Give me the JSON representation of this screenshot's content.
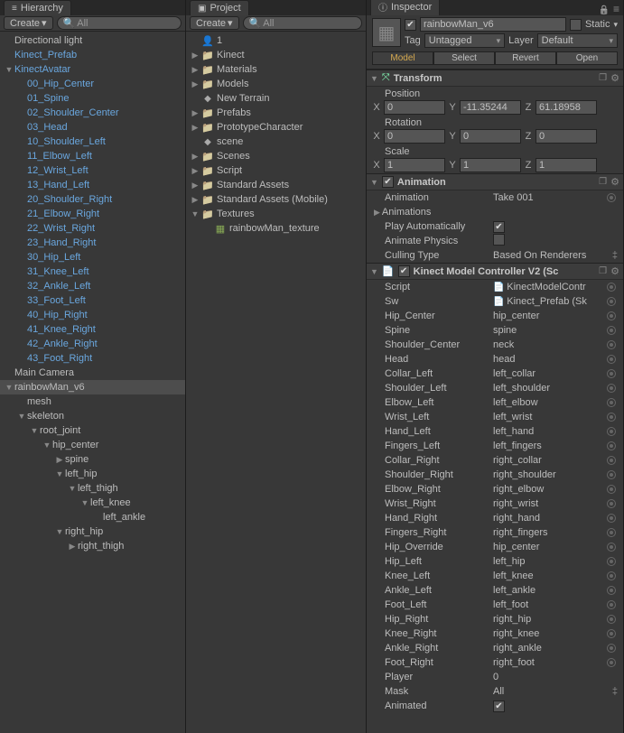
{
  "hierarchy": {
    "tab": "Hierarchy",
    "create": "Create",
    "search": "All",
    "items": [
      {
        "label": "Directional light",
        "depth": 0,
        "arrow": "",
        "blue": false
      },
      {
        "label": "Kinect_Prefab",
        "depth": 0,
        "arrow": "",
        "blue": true
      },
      {
        "label": "KinectAvatar",
        "depth": 0,
        "arrow": "▼",
        "blue": true
      },
      {
        "label": "00_Hip_Center",
        "depth": 1,
        "arrow": "",
        "blue": true
      },
      {
        "label": "01_Spine",
        "depth": 1,
        "arrow": "",
        "blue": true
      },
      {
        "label": "02_Shoulder_Center",
        "depth": 1,
        "arrow": "",
        "blue": true
      },
      {
        "label": "03_Head",
        "depth": 1,
        "arrow": "",
        "blue": true
      },
      {
        "label": "10_Shoulder_Left",
        "depth": 1,
        "arrow": "",
        "blue": true
      },
      {
        "label": "11_Elbow_Left",
        "depth": 1,
        "arrow": "",
        "blue": true
      },
      {
        "label": "12_Wrist_Left",
        "depth": 1,
        "arrow": "",
        "blue": true
      },
      {
        "label": "13_Hand_Left",
        "depth": 1,
        "arrow": "",
        "blue": true
      },
      {
        "label": "20_Shoulder_Right",
        "depth": 1,
        "arrow": "",
        "blue": true
      },
      {
        "label": "21_Elbow_Right",
        "depth": 1,
        "arrow": "",
        "blue": true
      },
      {
        "label": "22_Wrist_Right",
        "depth": 1,
        "arrow": "",
        "blue": true
      },
      {
        "label": "23_Hand_Right",
        "depth": 1,
        "arrow": "",
        "blue": true
      },
      {
        "label": "30_Hip_Left",
        "depth": 1,
        "arrow": "",
        "blue": true
      },
      {
        "label": "31_Knee_Left",
        "depth": 1,
        "arrow": "",
        "blue": true
      },
      {
        "label": "32_Ankle_Left",
        "depth": 1,
        "arrow": "",
        "blue": true
      },
      {
        "label": "33_Foot_Left",
        "depth": 1,
        "arrow": "",
        "blue": true
      },
      {
        "label": "40_Hip_Right",
        "depth": 1,
        "arrow": "",
        "blue": true
      },
      {
        "label": "41_Knee_Right",
        "depth": 1,
        "arrow": "",
        "blue": true
      },
      {
        "label": "42_Ankle_Right",
        "depth": 1,
        "arrow": "",
        "blue": true
      },
      {
        "label": "43_Foot_Right",
        "depth": 1,
        "arrow": "",
        "blue": true
      },
      {
        "label": "Main Camera",
        "depth": 0,
        "arrow": "",
        "blue": false
      },
      {
        "label": "rainbowMan_v6",
        "depth": 0,
        "arrow": "▼",
        "blue": false,
        "selected": true
      },
      {
        "label": "mesh",
        "depth": 1,
        "arrow": "",
        "blue": false
      },
      {
        "label": "skeleton",
        "depth": 1,
        "arrow": "▼",
        "blue": false
      },
      {
        "label": "root_joint",
        "depth": 2,
        "arrow": "▼",
        "blue": false
      },
      {
        "label": "hip_center",
        "depth": 3,
        "arrow": "▼",
        "blue": false
      },
      {
        "label": "spine",
        "depth": 4,
        "arrow": "▶",
        "blue": false
      },
      {
        "label": "left_hip",
        "depth": 4,
        "arrow": "▼",
        "blue": false
      },
      {
        "label": "left_thigh",
        "depth": 5,
        "arrow": "▼",
        "blue": false
      },
      {
        "label": "left_knee",
        "depth": 6,
        "arrow": "▼",
        "blue": false
      },
      {
        "label": "left_ankle",
        "depth": 7,
        "arrow": "",
        "blue": false
      },
      {
        "label": "right_hip",
        "depth": 4,
        "arrow": "▼",
        "blue": false
      },
      {
        "label": "right_thigh",
        "depth": 5,
        "arrow": "▶",
        "blue": false
      }
    ]
  },
  "project": {
    "tab": "Project",
    "create": "Create",
    "search": "All",
    "items": [
      {
        "label": "1",
        "depth": 0,
        "arrow": "",
        "icon": "avatar"
      },
      {
        "label": "Kinect",
        "depth": 0,
        "arrow": "▶",
        "icon": "folder"
      },
      {
        "label": "Materials",
        "depth": 0,
        "arrow": "▶",
        "icon": "folder"
      },
      {
        "label": "Models",
        "depth": 0,
        "arrow": "▶",
        "icon": "folder"
      },
      {
        "label": "New Terrain",
        "depth": 0,
        "arrow": "",
        "icon": "scene"
      },
      {
        "label": "Prefabs",
        "depth": 0,
        "arrow": "▶",
        "icon": "folder"
      },
      {
        "label": "PrototypeCharacter",
        "depth": 0,
        "arrow": "▶",
        "icon": "folder"
      },
      {
        "label": "scene",
        "depth": 0,
        "arrow": "",
        "icon": "scene"
      },
      {
        "label": "Scenes",
        "depth": 0,
        "arrow": "▶",
        "icon": "folder"
      },
      {
        "label": "Script",
        "depth": 0,
        "arrow": "▶",
        "icon": "folder"
      },
      {
        "label": "Standard Assets",
        "depth": 0,
        "arrow": "▶",
        "icon": "folder"
      },
      {
        "label": "Standard Assets (Mobile)",
        "depth": 0,
        "arrow": "▶",
        "icon": "folder"
      },
      {
        "label": "Textures",
        "depth": 0,
        "arrow": "▼",
        "icon": "folder"
      },
      {
        "label": "rainbowMan_texture",
        "depth": 1,
        "arrow": "",
        "icon": "tex"
      }
    ]
  },
  "inspector": {
    "tab": "Inspector",
    "name": "rainbowMan_v6",
    "enabled": true,
    "static_label": "Static",
    "tag_label": "Tag",
    "tag_value": "Untagged",
    "layer_label": "Layer",
    "layer_value": "Default",
    "buttons": {
      "model": "Model",
      "select": "Select",
      "revert": "Revert",
      "open": "Open"
    },
    "transform": {
      "title": "Transform",
      "pos_label": "Position",
      "pos": {
        "x": "0",
        "y": "-11.35244",
        "z": "61.18958"
      },
      "rot_label": "Rotation",
      "rot": {
        "x": "0",
        "y": "0",
        "z": "0"
      },
      "scale_label": "Scale",
      "scale": {
        "x": "1",
        "y": "1",
        "z": "1"
      },
      "axis": {
        "x": "X",
        "y": "Y",
        "z": "Z"
      }
    },
    "animation": {
      "title": "Animation",
      "rows": [
        {
          "label": "Animation",
          "value": "Take 001",
          "obj": true
        },
        {
          "label": "Animations",
          "value": "",
          "arrow": "▶"
        },
        {
          "label": "Play Automatically",
          "value": "",
          "check": true
        },
        {
          "label": "Animate Physics",
          "value": "",
          "check": false
        },
        {
          "label": "Culling Type",
          "value": "Based On Renderers",
          "dropdown": true
        }
      ]
    },
    "kinect": {
      "title": "Kinect Model Controller V2 (Sc",
      "rows": [
        {
          "label": "Script",
          "value": "KinectModelContr",
          "obj": true,
          "icon": "script"
        },
        {
          "label": "Sw",
          "value": "Kinect_Prefab (Sk",
          "obj": true,
          "icon": "script"
        },
        {
          "label": "Hip_Center",
          "value": "hip_center",
          "obj": true
        },
        {
          "label": "Spine",
          "value": "spine",
          "obj": true
        },
        {
          "label": "Shoulder_Center",
          "value": "neck",
          "obj": true
        },
        {
          "label": "Head",
          "value": "head",
          "obj": true
        },
        {
          "label": "Collar_Left",
          "value": "left_collar",
          "obj": true
        },
        {
          "label": "Shoulder_Left",
          "value": "left_shoulder",
          "obj": true
        },
        {
          "label": "Elbow_Left",
          "value": "left_elbow",
          "obj": true
        },
        {
          "label": "Wrist_Left",
          "value": "left_wrist",
          "obj": true
        },
        {
          "label": "Hand_Left",
          "value": "left_hand",
          "obj": true
        },
        {
          "label": "Fingers_Left",
          "value": "left_fingers",
          "obj": true
        },
        {
          "label": "Collar_Right",
          "value": "right_collar",
          "obj": true
        },
        {
          "label": "Shoulder_Right",
          "value": "right_shoulder",
          "obj": true
        },
        {
          "label": "Elbow_Right",
          "value": "right_elbow",
          "obj": true
        },
        {
          "label": "Wrist_Right",
          "value": "right_wrist",
          "obj": true
        },
        {
          "label": "Hand_Right",
          "value": "right_hand",
          "obj": true
        },
        {
          "label": "Fingers_Right",
          "value": "right_fingers",
          "obj": true
        },
        {
          "label": "Hip_Override",
          "value": "hip_center",
          "obj": true
        },
        {
          "label": "Hip_Left",
          "value": "left_hip",
          "obj": true
        },
        {
          "label": "Knee_Left",
          "value": "left_knee",
          "obj": true
        },
        {
          "label": "Ankle_Left",
          "value": "left_ankle",
          "obj": true
        },
        {
          "label": "Foot_Left",
          "value": "left_foot",
          "obj": true
        },
        {
          "label": "Hip_Right",
          "value": "right_hip",
          "obj": true
        },
        {
          "label": "Knee_Right",
          "value": "right_knee",
          "obj": true
        },
        {
          "label": "Ankle_Right",
          "value": "right_ankle",
          "obj": true
        },
        {
          "label": "Foot_Right",
          "value": "right_foot",
          "obj": true
        },
        {
          "label": "Player",
          "value": "0"
        },
        {
          "label": "Mask",
          "value": "All",
          "dropdown": true
        },
        {
          "label": "Animated",
          "value": "",
          "check": true
        }
      ]
    }
  }
}
